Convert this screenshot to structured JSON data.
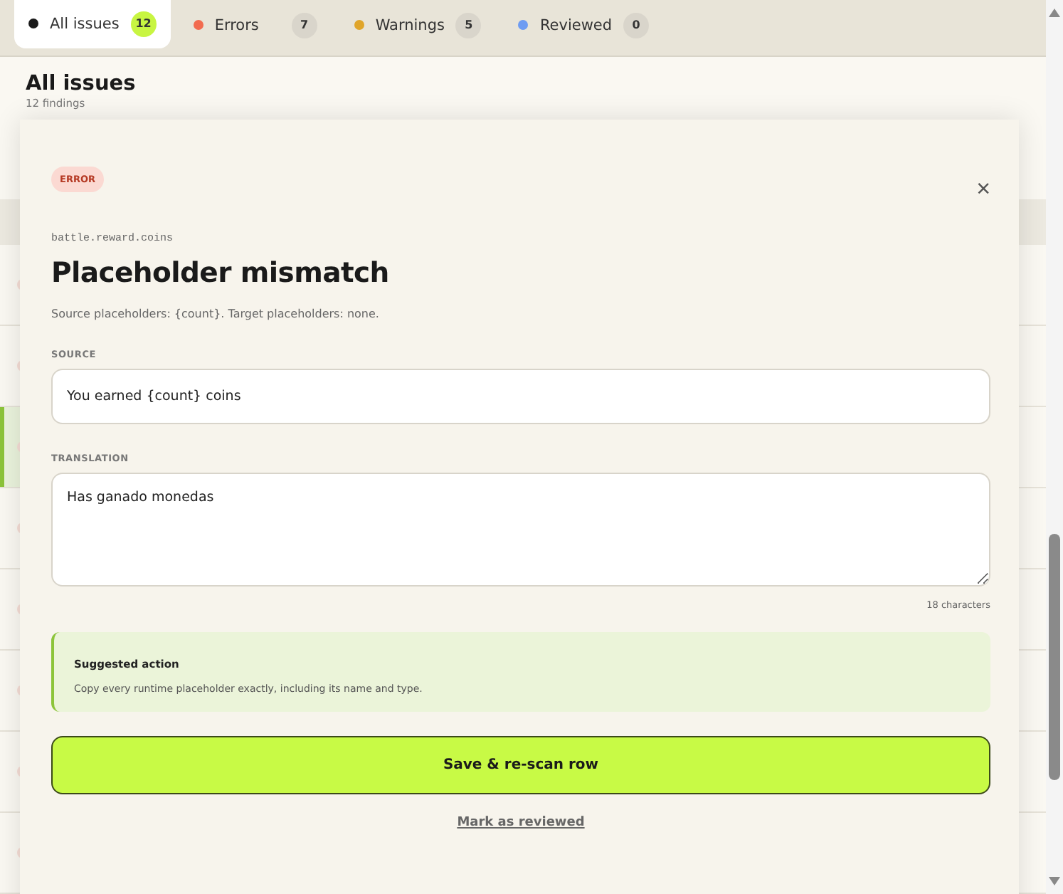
{
  "tabs": [
    {
      "label": "All issues",
      "count": "12",
      "color": "#1a1a1a",
      "selected": true
    },
    {
      "label": "Errors",
      "count": "7",
      "color": "#f26b4f",
      "selected": false
    },
    {
      "label": "Warnings",
      "count": "5",
      "color": "#e0a52a",
      "selected": false
    },
    {
      "label": "Reviewed",
      "count": "0",
      "color": "#6e9cf2",
      "selected": false
    }
  ],
  "header": {
    "title": "All issues",
    "subtitle": "12 findings"
  },
  "background_rows": [
    {
      "selected": false
    },
    {
      "selected": false
    },
    {
      "selected": true
    },
    {
      "selected": false
    },
    {
      "selected": false
    },
    {
      "selected": false
    },
    {
      "selected": false
    },
    {
      "selected": false
    }
  ],
  "dialog": {
    "badge": "ERROR",
    "key": "battle.reward.coins",
    "title": "Placeholder mismatch",
    "description": "Source placeholders: {count}. Target placeholders: none.",
    "close": "×",
    "source_label": "SOURCE",
    "source_value": "You earned {count} coins",
    "translation_label": "TRANSLATION",
    "translation_value": "Has ganado monedas",
    "char_count": "18 characters",
    "suggestion_title": "Suggested action",
    "suggestion_text": "Copy every runtime placeholder exactly, including its name and type.",
    "primary_button": "Save & re-scan row",
    "secondary_link": "Mark as reviewed"
  }
}
